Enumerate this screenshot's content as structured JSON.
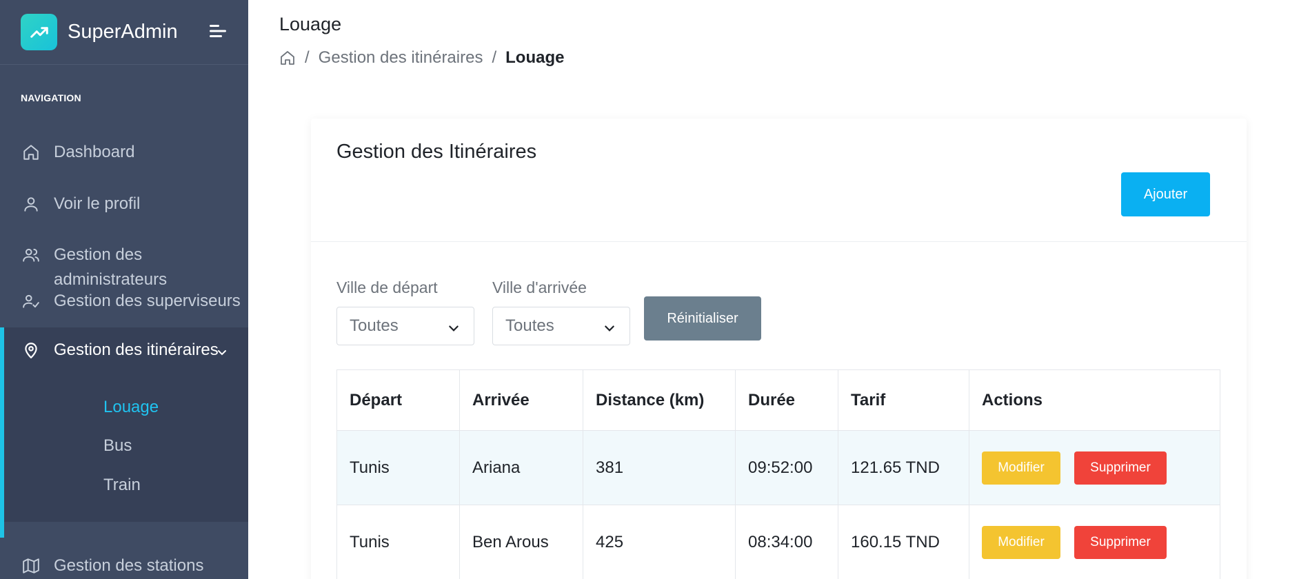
{
  "app": {
    "name": "SuperAdmin",
    "logo_icon": "trending-up-icon",
    "accent": "#1ec3e6"
  },
  "sidebar": {
    "heading": "NAVIGATION",
    "items": [
      {
        "label": "Dashboard",
        "icon": "home-icon"
      },
      {
        "label": "Voir le profil",
        "icon": "user-icon"
      },
      {
        "label_line1": "Gestion des",
        "label_line2": "administrateurs",
        "icon": "users-icon"
      },
      {
        "label": "Gestion des superviseurs",
        "icon": "user-check-icon"
      },
      {
        "label": "Gestion des itinéraires",
        "icon": "map-pin-icon",
        "active": true
      },
      {
        "label": "Gestion des stations",
        "icon": "map-icon"
      }
    ],
    "submenu": [
      {
        "label": "Louage",
        "active": true
      },
      {
        "label": "Bus"
      },
      {
        "label": "Train"
      }
    ]
  },
  "header": {
    "title": "Louage",
    "breadcrumb": {
      "parent": "Gestion des itinéraires",
      "current": "Louage",
      "separator": "/"
    }
  },
  "card": {
    "title": "Gestion des Itinéraires",
    "add_label": "Ajouter",
    "filters": {
      "departure_label": "Ville de départ",
      "departure_value": "Toutes",
      "arrival_label": "Ville d'arrivée",
      "arrival_value": "Toutes",
      "reset_label": "Réinitialiser"
    },
    "table": {
      "columns": [
        "Départ",
        "Arrivée",
        "Distance (km)",
        "Durée",
        "Tarif",
        "Actions"
      ],
      "rows": [
        {
          "depart": "Tunis",
          "arrivee": "Ariana",
          "distance": "381",
          "duree": "09:52:00",
          "tarif": "121.65 TND"
        },
        {
          "depart": "Tunis",
          "arrivee": "Ben Arous",
          "distance": "425",
          "duree": "08:34:00",
          "tarif": "160.15 TND"
        }
      ],
      "edit_label": "Modifier",
      "delete_label": "Supprimer"
    }
  },
  "colors": {
    "sidebar_bg": "#3f4b63",
    "primary": "#0ab0f2",
    "warning": "#f4c430",
    "danger": "#f0433a",
    "secondary": "#6b7f8e"
  }
}
